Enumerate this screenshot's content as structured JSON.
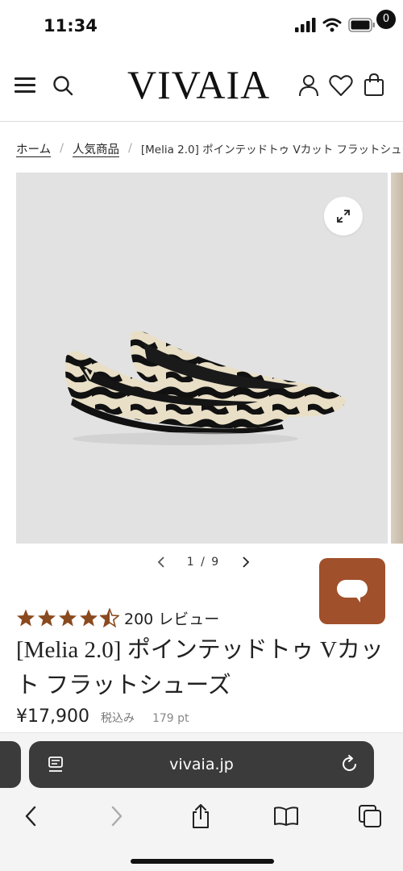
{
  "status_bar": {
    "time": "11:34"
  },
  "header": {
    "logo": "VIVAIA",
    "cart_count": "0"
  },
  "breadcrumb": {
    "home": "ホーム",
    "category": "人気商品",
    "current": "[Melia 2.0] ポインテッドトゥ Vカット フラットシューズ"
  },
  "gallery": {
    "current": "1",
    "total": "9",
    "counter": "1 / 9"
  },
  "product": {
    "rating_value": 4.5,
    "review_text": "200 レビュー",
    "title": "[Melia 2.0] ポインテッドトゥ Vカット フラットシューズ",
    "price": "¥17,900",
    "tax_note": "税込み",
    "points": "179 pt"
  },
  "browser": {
    "url": "vivaia.jp"
  },
  "colors": {
    "chat_button": "#a0502b",
    "star": "#8a4a1f",
    "gallery_bg": "#e2e2e2"
  },
  "icons": [
    "menu-icon",
    "search-icon",
    "account-icon",
    "heart-icon",
    "cart-icon",
    "expand-icon",
    "chevron-left-icon",
    "chevron-right-icon",
    "chat-icon",
    "reader-icon",
    "reload-icon",
    "back-icon",
    "forward-icon",
    "share-icon",
    "bookmarks-icon",
    "tabs-icon"
  ]
}
